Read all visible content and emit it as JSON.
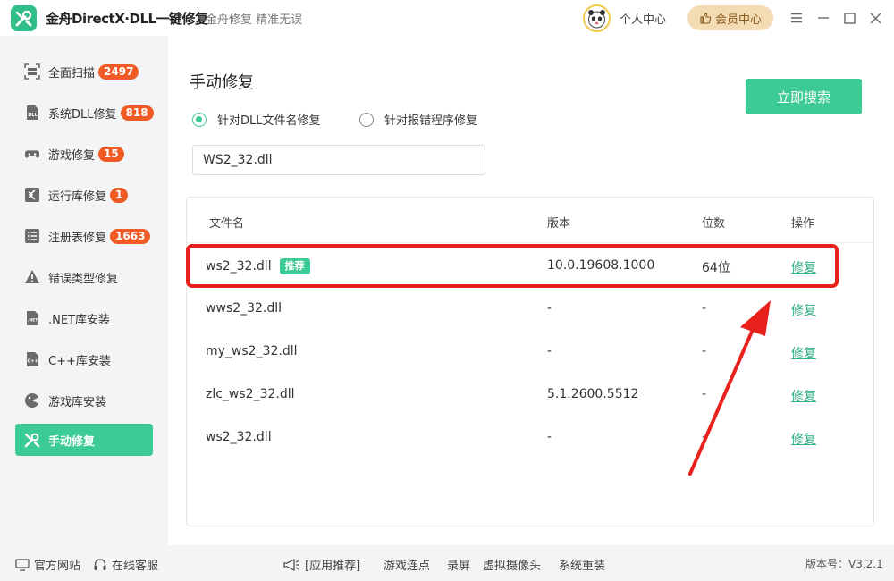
{
  "window": {
    "title": "金舟DirectX·DLL一键修复",
    "slogan": "金舟修复 精准无误",
    "user_center": "个人中心",
    "vip_label": "会员中心"
  },
  "sidebar": {
    "items": [
      {
        "label": "全面扫描",
        "badge": "2497",
        "icon": "scan-icon"
      },
      {
        "label": "系统DLL修复",
        "badge": "818",
        "icon": "dll-icon"
      },
      {
        "label": "游戏修复",
        "badge": "15",
        "icon": "gamepad-icon"
      },
      {
        "label": "运行库修复",
        "badge": "1",
        "icon": "runtime-icon"
      },
      {
        "label": "注册表修复",
        "badge": "1663",
        "icon": "registry-icon"
      },
      {
        "label": "错误类型修复",
        "badge": "",
        "icon": "warning-icon"
      },
      {
        "label": ".NET库安装",
        "badge": "",
        "icon": "dotnet-icon"
      },
      {
        "label": "C++库安装",
        "badge": "",
        "icon": "cpp-icon"
      },
      {
        "label": "游戏库安装",
        "badge": "",
        "icon": "game-lib-icon"
      },
      {
        "label": "手动修复",
        "badge": "",
        "icon": "wrench-icon",
        "active": true
      }
    ]
  },
  "main": {
    "title": "手动修复",
    "radio_options": [
      {
        "label": "针对DLL文件名修复",
        "checked": true
      },
      {
        "label": "针对报错程序修复",
        "checked": false
      }
    ],
    "search_value": "WS2_32.dll",
    "search_button": "立即搜索",
    "table": {
      "headers": {
        "name": "文件名",
        "version": "版本",
        "bits": "位数",
        "action": "操作"
      },
      "rows": [
        {
          "name": "ws2_32.dll",
          "tag": "推荐",
          "version": "10.0.19608.1000",
          "bits": "64位",
          "action": "修复"
        },
        {
          "name": "wws2_32.dll",
          "tag": "",
          "version": "-",
          "bits": "-",
          "action": "修复"
        },
        {
          "name": "my_ws2_32.dll",
          "tag": "",
          "version": "-",
          "bits": "-",
          "action": "修复"
        },
        {
          "name": "zlc_ws2_32.dll",
          "tag": "",
          "version": "5.1.2600.5512",
          "bits": "-",
          "action": "修复"
        },
        {
          "name": "ws2_32.dll",
          "tag": "",
          "version": "-",
          "bits": "-",
          "action": "修复"
        }
      ]
    }
  },
  "footer": {
    "official_site": "官方网站",
    "online_service": "在线客服",
    "recommend_label": "[应用推荐]",
    "links": [
      "游戏连点",
      "录屏",
      "虚拟摄像头",
      "系统重装"
    ],
    "version": "版本号：V3.2.1"
  },
  "colors": {
    "accent": "#3ccb95",
    "badge": "#f05a24",
    "highlight": "#e8211c",
    "vip": "#f3dbb4"
  }
}
